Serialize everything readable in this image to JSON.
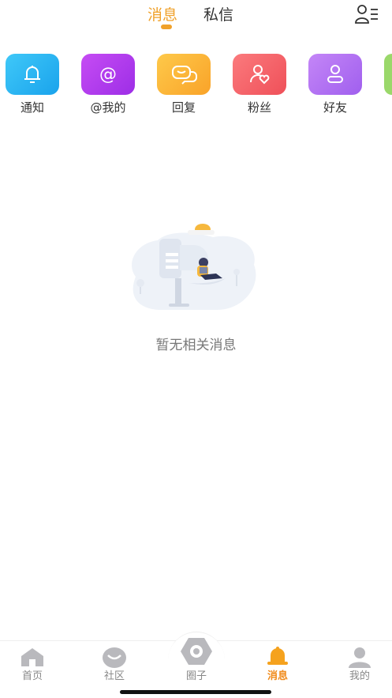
{
  "top_tabs": [
    {
      "label": "消息",
      "active": true
    },
    {
      "label": "私信",
      "active": false
    }
  ],
  "contacts_icon": "contacts-list-icon",
  "categories": [
    {
      "label": "通知",
      "icon": "bell-icon",
      "color": "#26b5f2"
    },
    {
      "label": "@我的",
      "icon": "at-icon",
      "color": "#b83ef0"
    },
    {
      "label": "回复",
      "icon": "chat-bubbles-icon",
      "color": "#fbb43a"
    },
    {
      "label": "粉丝",
      "icon": "user-heart-icon",
      "color": "#f4646a"
    },
    {
      "label": "好友",
      "icon": "user-icon",
      "color": "#b572f2"
    }
  ],
  "empty_state": {
    "text": "暂无相关消息"
  },
  "bottom_nav": [
    {
      "label": "首页",
      "icon": "home-icon",
      "active": false
    },
    {
      "label": "社区",
      "icon": "community-icon",
      "active": false
    },
    {
      "label": "圈子",
      "icon": "hexagon-circle-icon",
      "active": false
    },
    {
      "label": "消息",
      "icon": "bell-icon",
      "active": true
    },
    {
      "label": "我的",
      "icon": "profile-icon",
      "active": false
    }
  ],
  "colors": {
    "accent": "#f0a12a",
    "nav_active": "#f08a1a",
    "nav_inactive": "#888888"
  }
}
